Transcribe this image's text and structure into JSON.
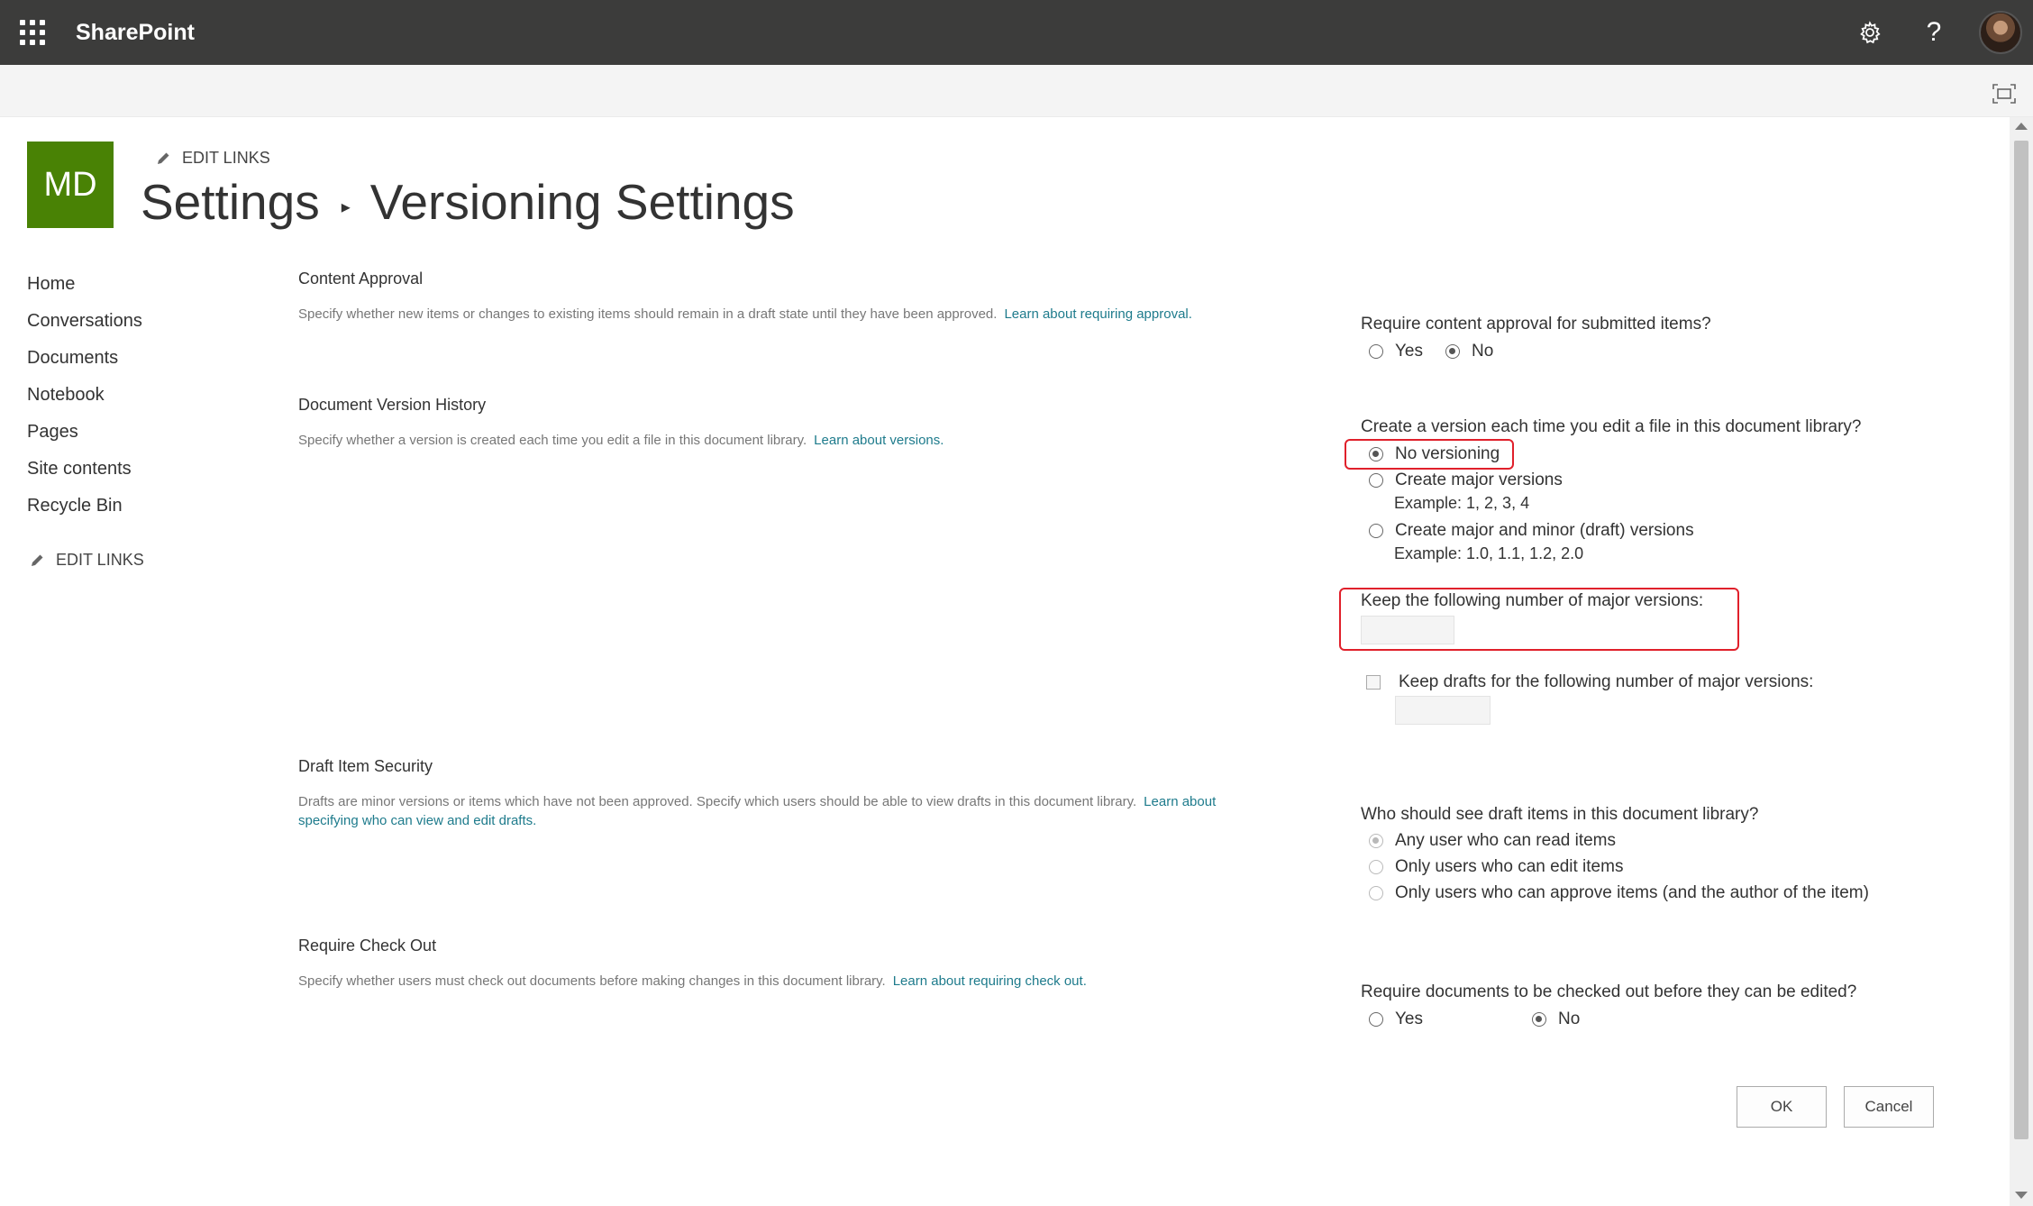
{
  "suite_bar": {
    "app_name": "SharePoint",
    "icons": [
      "app-launcher-icon",
      "gear-icon",
      "help-icon",
      "avatar"
    ],
    "help_glyph": "?"
  },
  "site": {
    "logo_text": "MD",
    "logo_color": "#498205",
    "edit_links_label": "EDIT LINKS"
  },
  "breadcrumb": {
    "parent": "Settings",
    "current": "Versioning Settings"
  },
  "left_nav": {
    "items": [
      "Home",
      "Conversations",
      "Documents",
      "Notebook",
      "Pages",
      "Site contents",
      "Recycle Bin"
    ],
    "edit_links_label": "EDIT LINKS"
  },
  "content_approval": {
    "heading": "Content Approval",
    "description": "Specify whether new items or changes to existing items should remain in a draft state until they have been approved.",
    "link": "Learn about requiring approval.",
    "question": "Require content approval for submitted items?",
    "options": [
      "Yes",
      "No"
    ],
    "selected": "No"
  },
  "version_history": {
    "heading": "Document Version History",
    "description": "Specify whether a version is created each time you edit a file in this document library.",
    "link": "Learn about versions.",
    "question": "Create a version each time you edit a file in this document library?",
    "options": [
      {
        "label": "No versioning",
        "example": ""
      },
      {
        "label": "Create major versions",
        "example": "Example: 1, 2, 3, 4"
      },
      {
        "label": "Create major and minor (draft) versions",
        "example": "Example: 1.0, 1.1, 1.2, 2.0"
      }
    ],
    "selected": "No versioning",
    "keep_major_label": "Keep the following number of major versions:",
    "keep_major_value": "",
    "keep_drafts_label": "Keep drafts for the following number of major versions:",
    "keep_drafts_checked": false,
    "keep_drafts_value": ""
  },
  "draft_security": {
    "heading": "Draft Item Security",
    "description": "Drafts are minor versions or items which have not been approved. Specify which users should be able to view drafts in this document library.",
    "link": "Learn about specifying who can view and edit drafts.",
    "question": "Who should see draft items in this document library?",
    "options": [
      "Any user who can read items",
      "Only users who can edit items",
      "Only users who can approve items (and the author of the item)"
    ],
    "selected": "Any user who can read items",
    "disabled": true
  },
  "check_out": {
    "heading": "Require Check Out",
    "description": "Specify whether users must check out documents before making changes in this document library.",
    "link": "Learn about requiring check out.",
    "question": "Require documents to be checked out before they can be edited?",
    "options": [
      "Yes",
      "No"
    ],
    "selected": "No"
  },
  "actions": {
    "ok_label": "OK",
    "cancel_label": "Cancel"
  },
  "colors": {
    "suite_bar": "#3c3c3b",
    "link": "#1e7b8c",
    "annotation": "#e0202b"
  }
}
